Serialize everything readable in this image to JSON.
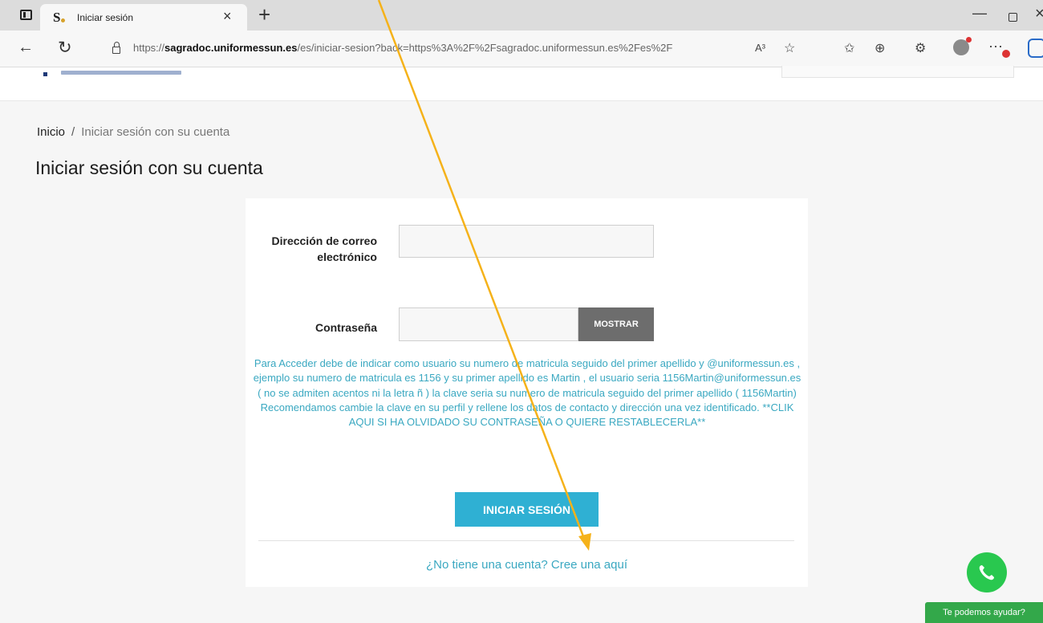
{
  "browser": {
    "tab_title": "Iniciar sesión",
    "tab_close": "×",
    "new_tab": "+",
    "url_prefix": "https://",
    "url_domain": "sagradoc.uniformessun.es",
    "url_path": "/es/iniciar-sesion?back=https%3A%2F%2Fsagradoc.uniformessun.es%2Fes%2F",
    "read_aloud": "A³",
    "icons": [
      "back-icon",
      "refresh-icon",
      "lock-icon",
      "read-aloud-icon",
      "favorite-icon",
      "favorites-icon",
      "collections-icon",
      "extensions-icon",
      "profile-icon",
      "more-icon",
      "bing-icon"
    ]
  },
  "breadcrumb": {
    "home": "Inicio",
    "separator": "/",
    "current": "Iniciar sesión con su cuenta"
  },
  "page_title": "Iniciar sesión con su cuenta",
  "form": {
    "email_label": "Dirección de correo electrónico",
    "email_value": "",
    "password_label": "Contraseña",
    "password_value": "",
    "show_button": "MOSTRAR",
    "help_text": "Para Acceder debe de indicar como usuario su numero de matricula seguido del primer apellido y @uniformessun.es , ejemplo su numero de matricula es 1156 y su primer apellido es Martin , el usuario seria 1156Martin@uniformessun.es ( no se admiten acentos ni la letra ñ ) la clave seria su numero de matricula seguido del primer apellido ( 1156Martin) Recomendamos cambie la clave en su perfil y rellene los datos de contacto y dirección una vez identificado. **CLIK AQUI SI HA OLVIDADO SU CONTRASEÑA O QUIERE RESTABLECERLA**",
    "login_button": "INICIAR SESIÓN",
    "register_link": "¿No tiene una cuenta? Cree una aquí"
  },
  "chat_widget": {
    "label": "Te podemos ayudar?"
  },
  "colors": {
    "accent": "#2fb0d3",
    "help_text": "#3aa8c1",
    "show_button": "#6d6d6d",
    "whatsapp": "#29c84f",
    "annotation_arrow": "#f5b21a"
  }
}
